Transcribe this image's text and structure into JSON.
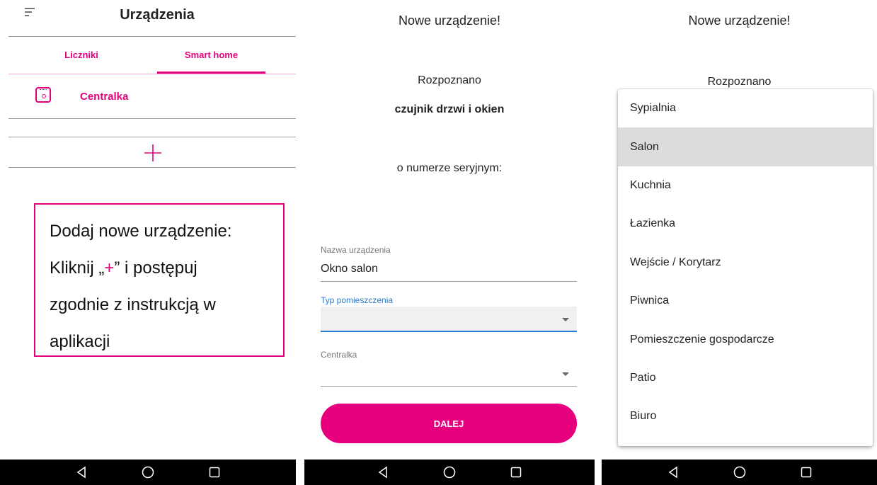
{
  "screen1": {
    "title": "Urządzenia",
    "tabs": [
      {
        "label": "Liczniki"
      },
      {
        "label": "Smart home",
        "active": true
      }
    ],
    "device": {
      "label": "Centralka",
      "icon": "hub-device-icon"
    },
    "add_icon": "plus-icon",
    "info": {
      "line1": "Dodaj nowe urządzenie:",
      "line2_prefix": "Kliknij „",
      "line2_plus": "+",
      "line2_suffix": "” i postępuj",
      "line3": "zgodnie z instrukcją w",
      "line4": "aplikacji"
    }
  },
  "screen2": {
    "title": "Nowe urządzenie!",
    "recognized": "Rozpoznano",
    "device_type": "czujnik drzwi i okien",
    "serial_label": "o numerze seryjnym:",
    "name_field": {
      "label": "Nazwa urządzenia",
      "value": "Okno salon"
    },
    "room_field": {
      "label": "Typ pomieszczenia",
      "value": ""
    },
    "hub_field": {
      "label": "Centralka",
      "value": ""
    },
    "next_button": "DALEJ"
  },
  "screen3": {
    "title": "Nowe urządzenie!",
    "recognized": "Rozpoznano",
    "options": [
      "Sypialnia",
      "Salon",
      "Kuchnia",
      "Łazienka",
      "Wejście / Korytarz",
      "Piwnica",
      "Pomieszczenie gospodarcze",
      "Patio",
      "Biuro"
    ],
    "highlighted_index": 1
  },
  "android_nav": {
    "back": "back-icon",
    "home": "home-icon",
    "recents": "recents-icon"
  },
  "colors": {
    "accent": "#e6007e",
    "focus": "#2a7ad2",
    "navbar": "#000000"
  }
}
